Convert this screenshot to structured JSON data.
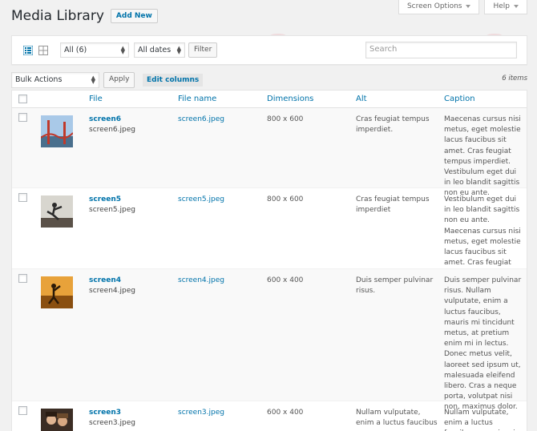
{
  "header": {
    "title": "Media Library",
    "add_new": "Add New",
    "screen_options": "Screen Options",
    "help": "Help"
  },
  "toolbar": {
    "type_filter": "All (6)",
    "date_filter": "All dates",
    "filter_button": "Filter",
    "search_placeholder": "Search"
  },
  "bulk": {
    "action": "Bulk Actions",
    "apply": "Apply",
    "edit_columns": "Edit columns",
    "items_count": "6 items"
  },
  "columns": [
    "File",
    "File name",
    "Dimensions",
    "Alt",
    "Caption"
  ],
  "rows": [
    {
      "title": "screen6",
      "file": "screen6.jpeg",
      "filename": "screen6.jpeg",
      "dimensions": "800 x 600",
      "alt": "Cras feugiat tempus imperdiet.",
      "caption": "Maecenas cursus nisi metus, eget molestie lacus faucibus sit amet. Cras feugiat tempus imperdiet. Vestibulum eget dui in leo blandit sagittis non eu ante."
    },
    {
      "title": "screen5",
      "file": "screen5.jpeg",
      "filename": "screen5.jpeg",
      "dimensions": "800 x 600",
      "alt": "Cras feugiat tempus imperdiet",
      "caption": "Vestibulum eget dui in leo blandit sagittis non eu ante. Maecenas cursus nisi metus, eget molestie lacus faucibus sit amet. Cras feugiat tempus imperdiet."
    },
    {
      "title": "screen4",
      "file": "screen4.jpeg",
      "filename": "screen4.jpeg",
      "dimensions": "600 x 400",
      "alt": "Duis semper pulvinar risus.",
      "caption": "Duis semper pulvinar risus. Nullam vulputate, enim a luctus faucibus, mauris mi tincidunt metus, at pretium enim mi in lectus. Donec metus velit, laoreet sed ipsum ut, malesuada eleifend libero. Cras a neque porta, volutpat nisi non, maximus dolor."
    },
    {
      "title": "screen3",
      "file": "screen3.jpeg",
      "filename": "screen3.jpeg",
      "dimensions": "600 x 400",
      "alt": "Nullam vulputate, enim a luctus faucibus",
      "caption": "Nullam vulputate, enim a luctus faucibus, mauris mi tincidunt"
    }
  ],
  "colors": {
    "accent": "#0073aa",
    "text": "#444444",
    "background": "#f1f1f1"
  }
}
